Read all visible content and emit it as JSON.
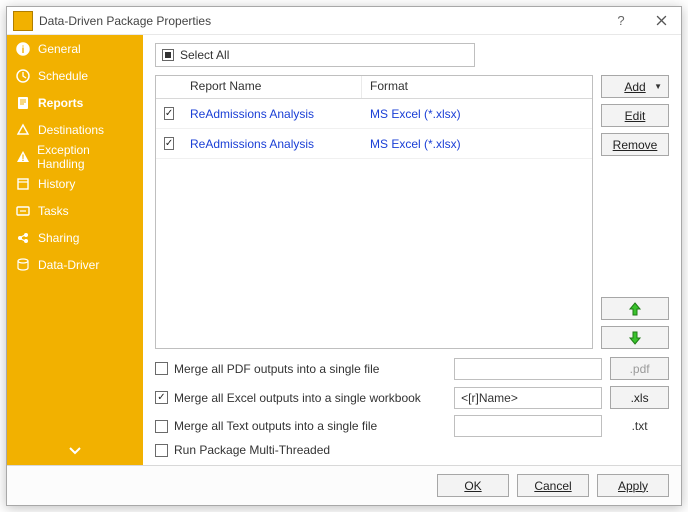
{
  "window": {
    "title": "Data-Driven Package Properties"
  },
  "sidebar": {
    "items": [
      {
        "label": "General"
      },
      {
        "label": "Schedule"
      },
      {
        "label": "Reports"
      },
      {
        "label": "Destinations"
      },
      {
        "label": "Exception Handling"
      },
      {
        "label": "History"
      },
      {
        "label": "Tasks"
      },
      {
        "label": "Sharing"
      },
      {
        "label": "Data-Driver"
      }
    ],
    "activeIndex": 2
  },
  "selectAll": {
    "label": "Select All",
    "state": "indeterminate"
  },
  "table": {
    "columns": {
      "name": "Report Name",
      "format": "Format"
    },
    "rows": [
      {
        "checked": true,
        "name": "ReAdmissions Analysis",
        "format": "MS Excel (*.xlsx)"
      },
      {
        "checked": true,
        "name": "ReAdmissions Analysis",
        "format": "MS Excel (*.xlsx)"
      }
    ]
  },
  "buttons": {
    "add": "Add",
    "edit": "Edit",
    "remove": "Remove",
    "ok": "OK",
    "cancel": "Cancel",
    "apply": "Apply"
  },
  "merge": {
    "pdf": {
      "label": "Merge all PDF outputs into a single file",
      "checked": false,
      "value": "",
      "ext": ".pdf",
      "extEnabled": false
    },
    "excel": {
      "label": "Merge all Excel outputs into a single workbook",
      "checked": true,
      "value": "<[r]Name>",
      "ext": ".xls",
      "extEnabled": true
    },
    "text": {
      "label": "Merge all Text outputs into a single file",
      "checked": false,
      "value": "",
      "ext": ".txt",
      "extEnabled": false
    },
    "multithread": {
      "label": "Run Package Multi-Threaded",
      "checked": false
    }
  }
}
